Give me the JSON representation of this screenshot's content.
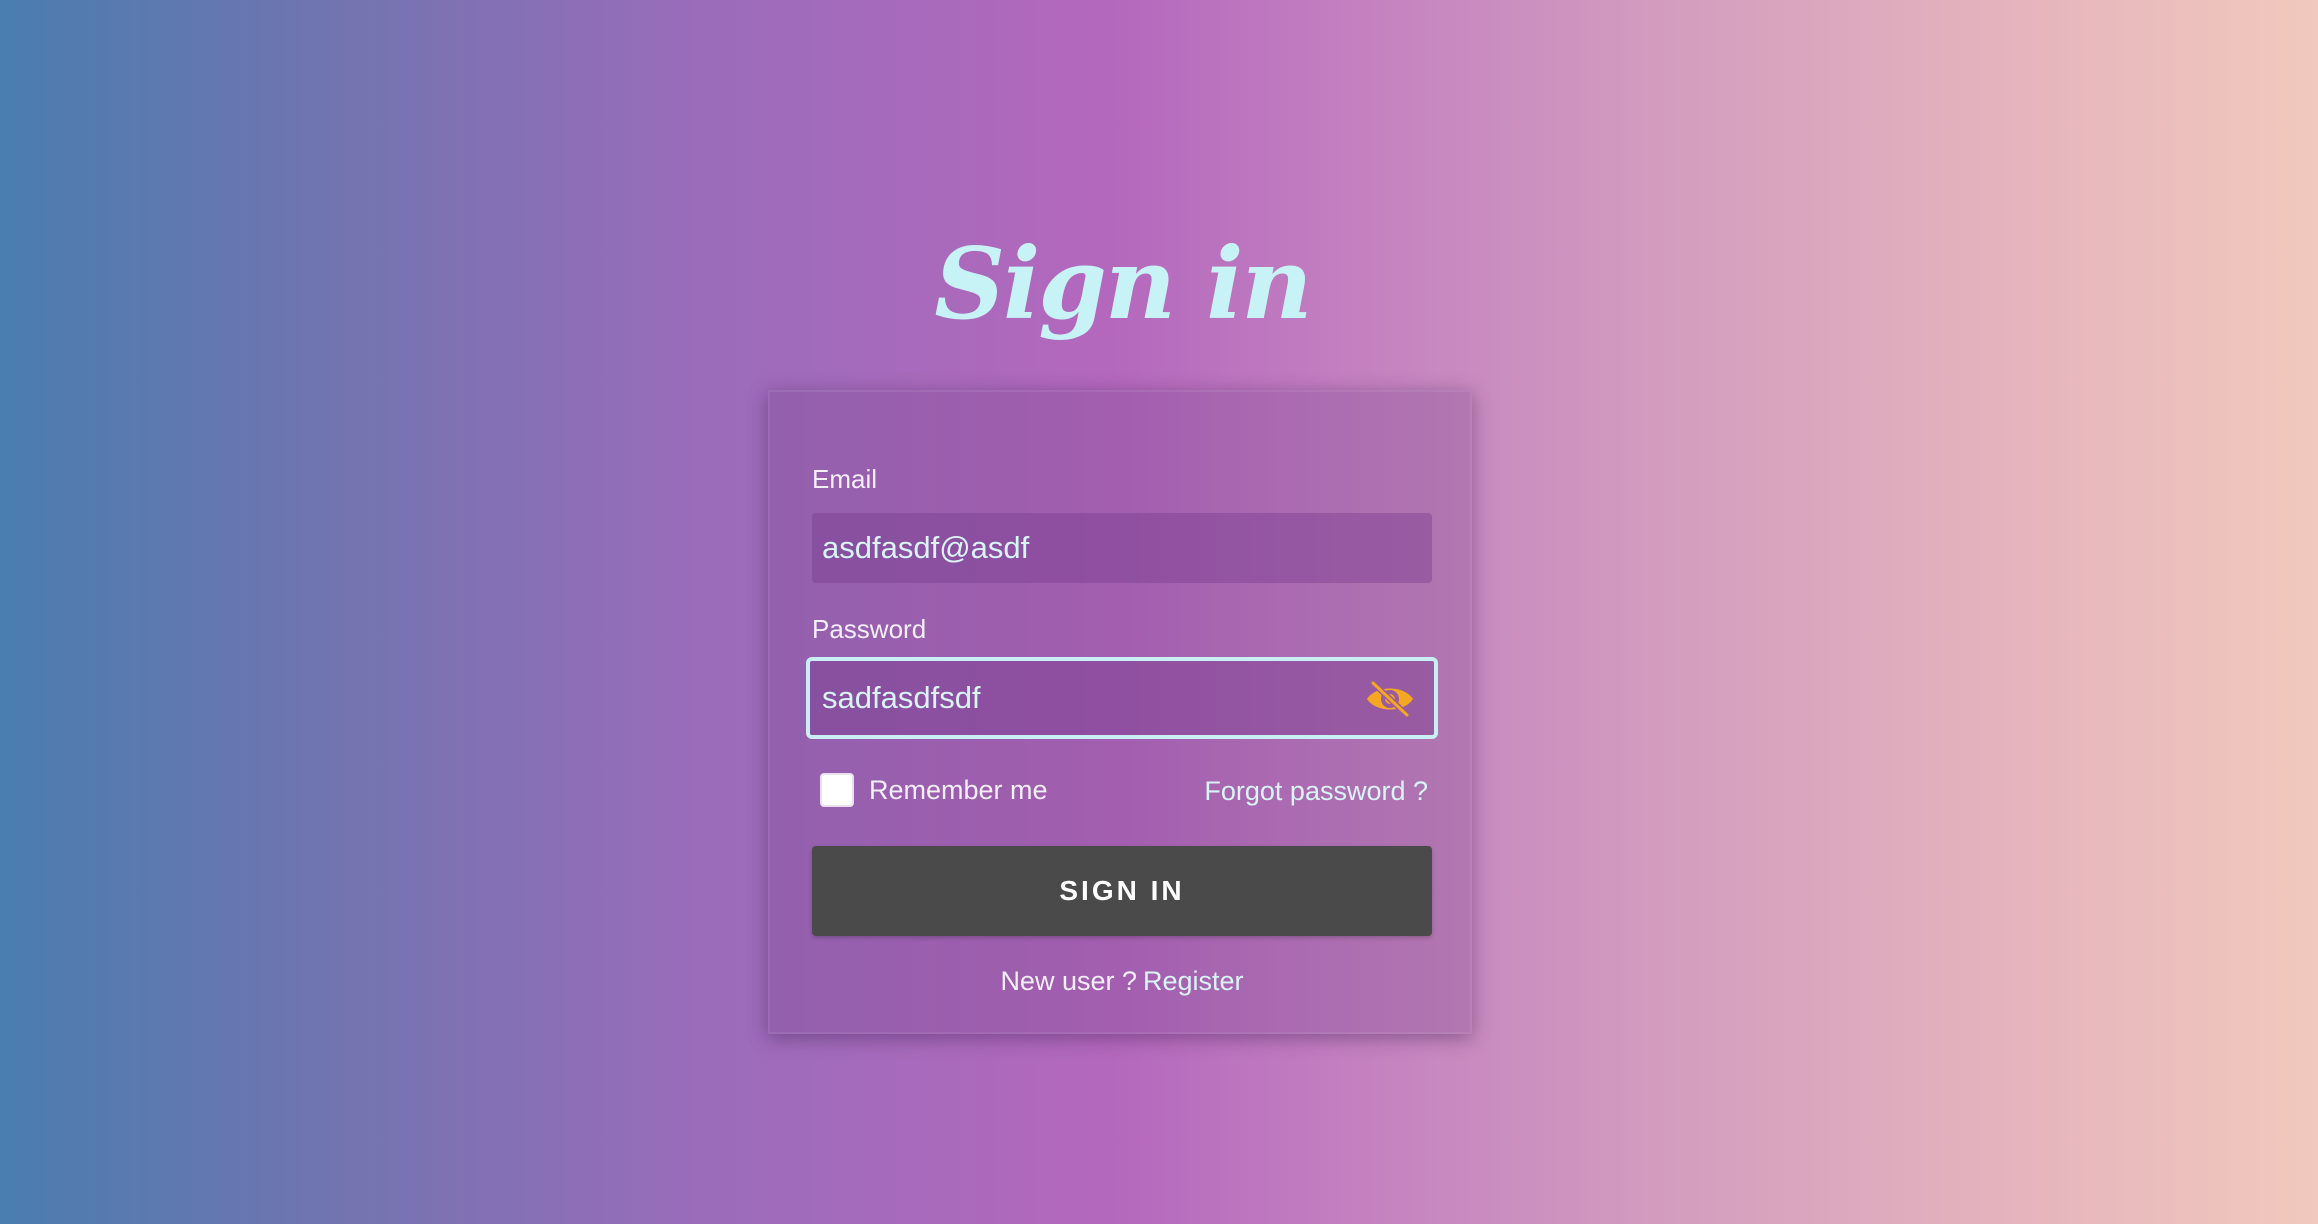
{
  "page": {
    "title": "Sign in"
  },
  "form": {
    "email": {
      "label": "Email",
      "value": "asdfasdf@asdf"
    },
    "password": {
      "label": "Password",
      "value": "sadfasdfsdf",
      "toggle_icon": "eye-slash-icon"
    },
    "remember": {
      "label": "Remember me",
      "checked": false
    },
    "forgot_label": "Forgot password ?",
    "submit_label": "SIGN IN",
    "new_user_label": "New user ?",
    "register_label": "Register"
  },
  "colors": {
    "title": "#c8f3f6",
    "button_bg": "#4a4a4a",
    "eye_icon": "#f5a623"
  }
}
